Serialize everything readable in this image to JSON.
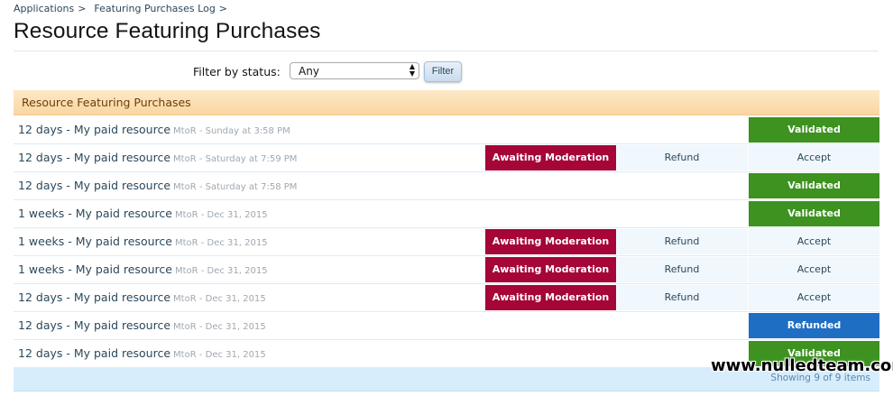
{
  "breadcrumb": [
    {
      "label": "Applications"
    },
    {
      "label": "Featuring Purchases Log"
    }
  ],
  "breadcrumb_sep": ">",
  "page_title": "Resource Featuring Purchases",
  "filter": {
    "label": "Filter by status:",
    "selected": "Any",
    "button_label": "Filter"
  },
  "section_title": "Resource Featuring Purchases",
  "rows": [
    {
      "title": "12 days - My paid resource",
      "meta": "MtoR - Sunday at 3:58 PM",
      "status": "Validated"
    },
    {
      "title": "12 days - My paid resource",
      "meta": "MtoR - Saturday at 7:59 PM",
      "status": "Awaiting Moderation",
      "refund": "Refund",
      "accept": "Accept"
    },
    {
      "title": "12 days - My paid resource",
      "meta": "MtoR - Saturday at 7:58 PM",
      "status": "Validated"
    },
    {
      "title": "1 weeks - My paid resource",
      "meta": "MtoR - Dec 31, 2015",
      "status": "Validated"
    },
    {
      "title": "1 weeks - My paid resource",
      "meta": "MtoR - Dec 31, 2015",
      "status": "Awaiting Moderation",
      "refund": "Refund",
      "accept": "Accept"
    },
    {
      "title": "1 weeks - My paid resource",
      "meta": "MtoR - Dec 31, 2015",
      "status": "Awaiting Moderation",
      "refund": "Refund",
      "accept": "Accept"
    },
    {
      "title": "12 days - My paid resource",
      "meta": "MtoR - Dec 31, 2015",
      "status": "Awaiting Moderation",
      "refund": "Refund",
      "accept": "Accept"
    },
    {
      "title": "12 days - My paid resource",
      "meta": "MtoR - Dec 31, 2015",
      "status": "Refunded"
    },
    {
      "title": "12 days - My paid resource",
      "meta": "MtoR - Dec 31, 2015",
      "status": "Validated"
    }
  ],
  "footer": {
    "showing": "Showing 9 of 9 items"
  },
  "watermark": "www.nulledteam.com",
  "colors": {
    "awaiting": "#a50537",
    "validated": "#3d9220",
    "refunded": "#1e6fc4",
    "header_bg": "#f9d6a2"
  }
}
